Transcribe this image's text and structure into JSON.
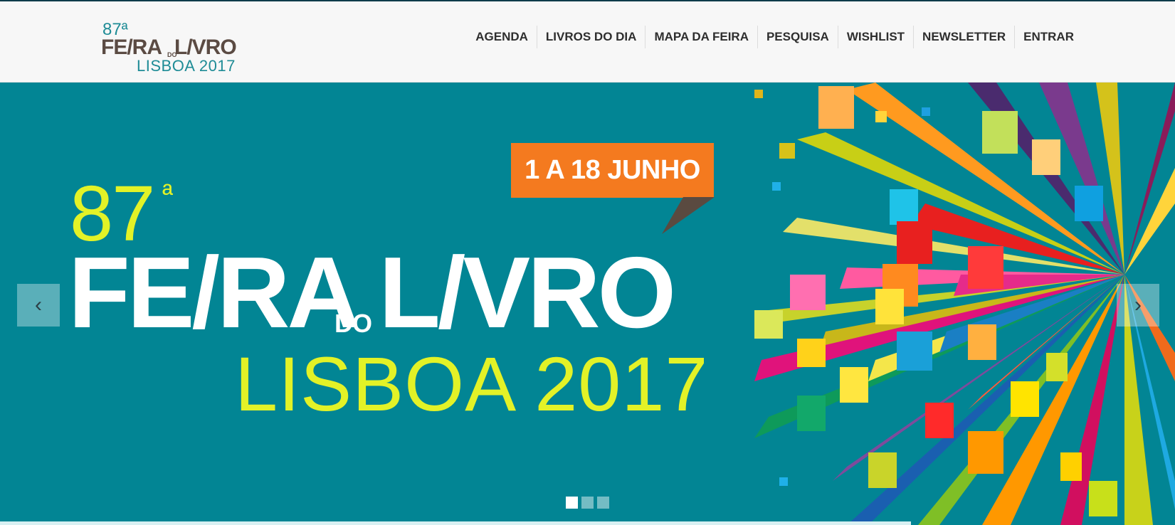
{
  "header": {
    "logo": {
      "ordinal": "87ª",
      "feira": "FE/RA",
      "do": "DO",
      "livro": "L/VRO",
      "city_year": "LISBOA 2017"
    },
    "nav": [
      "AGENDA",
      "LIVROS DO DIA",
      "MAPA DA FEIRA",
      "PESQUISA",
      "WISHLIST",
      "NEWSLETTER",
      "ENTRAR"
    ]
  },
  "hero": {
    "date_badge": "1 A 18 JUNHO",
    "edition": "87",
    "edition_ordinal": "ª",
    "title": "FE/RA L/VRO",
    "title_do": "DO",
    "subtitle": "LISBOA 2017",
    "prev_icon": "chevron-left-icon",
    "next_icon": "chevron-right-icon",
    "slides_total": 3,
    "slide_active": 1
  },
  "colors": {
    "hero_bg": "#028594",
    "accent_yellow": "#e3f227",
    "badge_orange": "#f47a1f",
    "logo_brown": "#5b4b43",
    "logo_teal": "#1f8c96"
  }
}
